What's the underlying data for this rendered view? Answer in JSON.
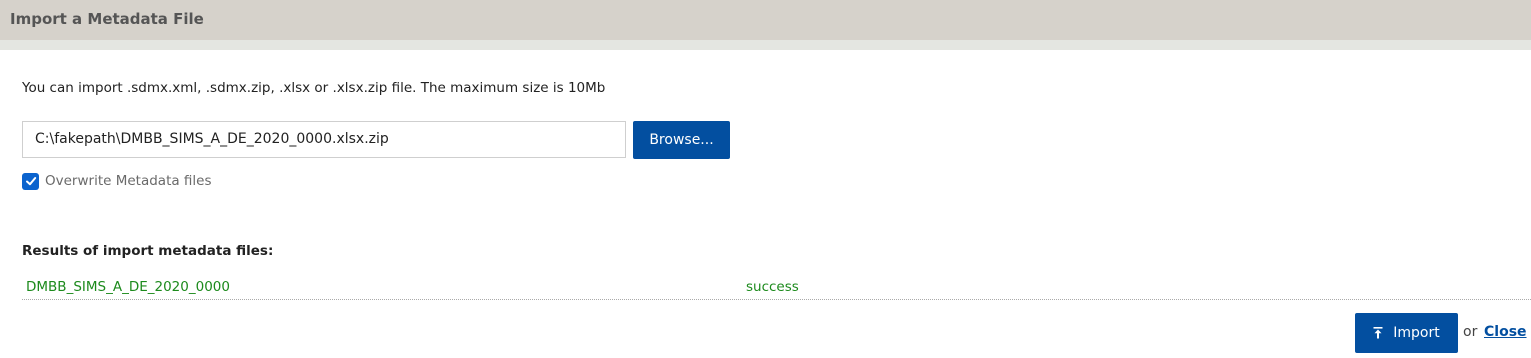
{
  "dialog": {
    "title": "Import a Metadata File"
  },
  "intro_text": "You can import .sdmx.xml, .sdmx.zip, .xlsx or .xlsx.zip file. The maximum size is 10Mb",
  "file_input": {
    "value": "C:\\fakepath\\DMBB_SIMS_A_DE_2020_0000.xlsx.zip"
  },
  "browse_label": "Browse...",
  "overwrite": {
    "label": "Overwrite Metadata files",
    "checked": true
  },
  "results": {
    "label": "Results of import metadata files:",
    "rows": [
      {
        "name": "DMBB_SIMS_A_DE_2020_0000",
        "status": "success"
      }
    ]
  },
  "footer": {
    "import_label": "Import",
    "or_text": "or",
    "close_label": "Close"
  },
  "colors": {
    "primary": "#034fa0",
    "success": "#1c8a1c",
    "titlebar": "#d6d2cb",
    "checkbox": "#0b63ce"
  },
  "icons": {
    "import": "upload-arrow-icon",
    "checkbox": "checkmark-icon"
  }
}
